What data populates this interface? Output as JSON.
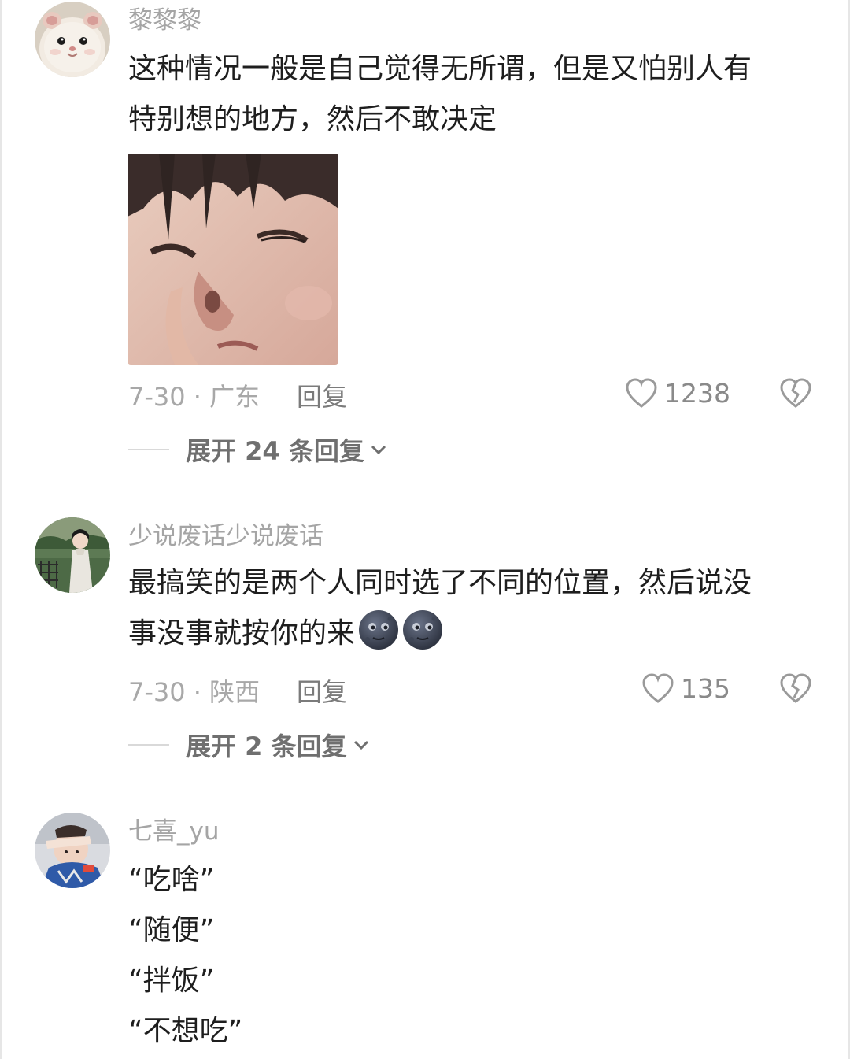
{
  "comments": [
    {
      "username": "黎黎黎",
      "lines": [
        "这种情况一般是自己觉得无所谓，但是又怕别人有",
        "特别想的地方，然后不敢决定"
      ],
      "date_location": "7-30 · 广东",
      "reply_label": "回复",
      "likes": "1238",
      "expand_label": "展开 24 条回复",
      "avatar_icon": "hamster-avatar",
      "sticker": "child-face-sticker"
    },
    {
      "username": "少说废话少说废话",
      "lines": [
        "最搞笑的是两个人同时选了不同的位置，然后说没",
        "事没事就按你的来"
      ],
      "emojis": [
        "new-moon-face-icon",
        "new-moon-face-icon"
      ],
      "date_location": "7-30 · 陕西",
      "reply_label": "回复",
      "likes": "135",
      "expand_label": "展开 2 条回复",
      "avatar_icon": "girl-garden-avatar"
    },
    {
      "username": "七喜_yu",
      "lines": [
        "“吃啥”",
        "“随便”",
        "“拌饭”",
        "“不想吃”"
      ],
      "avatar_icon": "kid-photo-avatar"
    }
  ],
  "colors": {
    "username": "#a5a5a5",
    "body_text": "#1e1e1e",
    "meta": "#a8a8a8",
    "expand": "#6f6f6f"
  }
}
